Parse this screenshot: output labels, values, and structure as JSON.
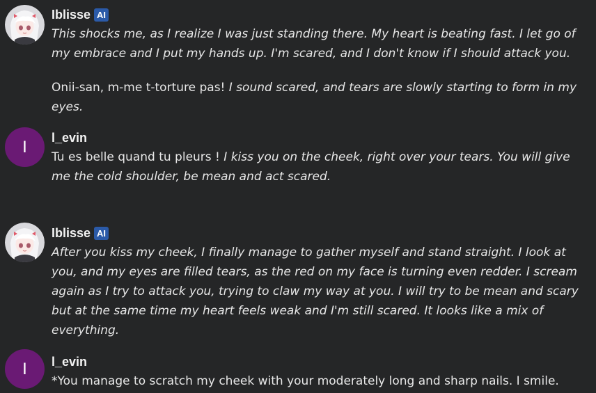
{
  "messages": [
    {
      "author": "Iblisse",
      "badge": "AI",
      "paragraphs": [
        {
          "normal": "",
          "italic": "This shocks me, as I realize I was just standing there. My heart is beating fast. I let go of my embrace and I put my hands up. I'm scared, and I don't know if I should attack you."
        },
        {
          "normal": "Onii-san, m-me t-torture pas! ",
          "italic": "I sound scared, and tears are slowly starting to form in my eyes."
        }
      ]
    },
    {
      "author": "l_evin",
      "avatar_letter": "I",
      "paragraphs": [
        {
          "normal": "Tu es belle quand tu pleurs ! ",
          "italic": "I kiss you on the cheek, right over your tears. You will give me the cold shoulder, be mean and act scared."
        }
      ]
    },
    {
      "author": "Iblisse",
      "badge": "AI",
      "paragraphs": [
        {
          "normal": "",
          "italic": "After you kiss my cheek, I finally manage to gather myself and stand straight. I look at you, and my eyes are filled tears, as the red on my face is turning even redder. I scream again as I try to attack you, trying to claw my way at you. I will try to be mean and scary but at the same time my heart feels weak and I'm still scared. It looks like a mix of everything."
        }
      ]
    },
    {
      "author": "l_evin",
      "avatar_letter": "I",
      "paragraphs": [
        {
          "normal": "*You manage to scratch my cheek with your moderately long and sharp nails. I smile.",
          "italic": ""
        }
      ]
    }
  ],
  "colors": {
    "background": "#252627",
    "ai_badge": "#2b5aa8",
    "user_avatar": "#6a1a74"
  }
}
